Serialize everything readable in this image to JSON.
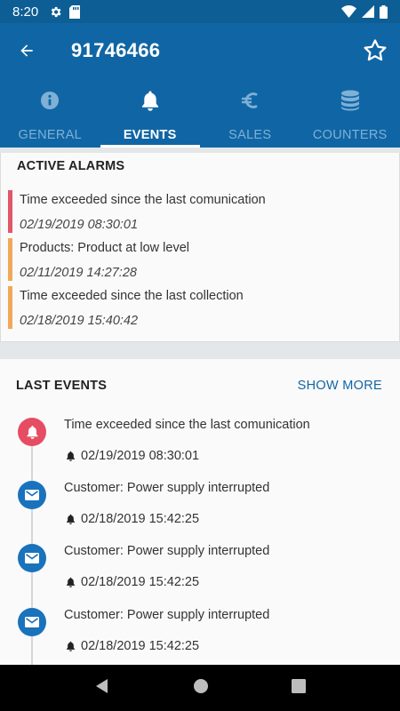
{
  "status_bar": {
    "time": "8:20",
    "icons": [
      "gear-icon",
      "sd-card-icon",
      "wifi-icon",
      "signal-icon",
      "battery-icon"
    ]
  },
  "app_bar": {
    "title": "91746466",
    "back_icon": "arrow-back-icon",
    "favorite_icon": "star-outline-icon"
  },
  "tabs": [
    {
      "label": "GENERAL",
      "icon": "info-icon",
      "active": false
    },
    {
      "label": "EVENTS",
      "icon": "bell-icon",
      "active": true
    },
    {
      "label": "SALES",
      "icon": "euro-icon",
      "active": false
    },
    {
      "label": "COUNTERS",
      "icon": "database-icon",
      "active": false
    }
  ],
  "active_alarms": {
    "heading": "ACTIVE ALARMS",
    "items": [
      {
        "text": "Time exceeded since the last comunication",
        "date": "02/19/2019 08:30:01",
        "color": "#e0566b"
      },
      {
        "text": "Products: Product at low level",
        "date": "02/11/2019 14:27:28",
        "color": "#f0a85a"
      },
      {
        "text": "Time exceeded since the last collection",
        "date": "02/18/2019 15:40:42",
        "color": "#f0a85a"
      }
    ]
  },
  "last_events": {
    "heading": "LAST EVENTS",
    "show_more": "SHOW MORE",
    "items": [
      {
        "text": "Time exceeded since the last comunication",
        "date": "02/19/2019 08:30:01",
        "icon": "bell-icon",
        "color": "#e64d63"
      },
      {
        "text": "Customer: Power supply interrupted",
        "date": "02/18/2019 15:42:25",
        "icon": "envelope-icon",
        "color": "#1a72bd"
      },
      {
        "text": "Customer: Power supply interrupted",
        "date": "02/18/2019 15:42:25",
        "icon": "envelope-icon",
        "color": "#1a72bd"
      },
      {
        "text": "Customer: Power supply interrupted",
        "date": "02/18/2019 15:42:25",
        "icon": "envelope-icon",
        "color": "#1a72bd"
      }
    ]
  },
  "colors": {
    "primary": "#1066a5",
    "status_bar": "#0d5e95",
    "tab_inactive": "#7fb0d6",
    "link": "#1066a5"
  }
}
